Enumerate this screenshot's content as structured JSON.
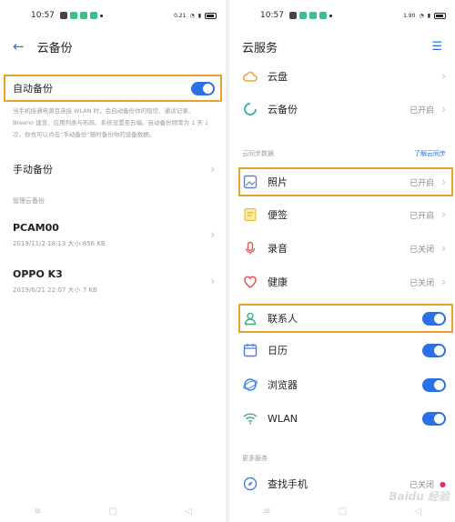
{
  "left": {
    "status": {
      "time": "10:57",
      "net_speed": "0.21"
    },
    "title": "云备份",
    "auto_backup": {
      "label": "自动备份",
      "on": true
    },
    "description": "当手机接通电源且连接 WLAN 时，会自动备份你的短信、通话记录、Breeno 速览、应用列表与布局、系统设置至云端。自动备份频率为 1 天 1 次，你也可以点击“手动备份”随时备份你的设备数据。",
    "manual_backup": "手动备份",
    "manage_section": "管理云备份",
    "devices": [
      {
        "name": "PCAM00",
        "sub": "2019/11/2 18:13  大小 856 KB"
      },
      {
        "name": "OPPO K3",
        "sub": "2019/6/21 22:07  大小 7 KB"
      }
    ]
  },
  "right": {
    "status": {
      "time": "10:57",
      "net_speed": "1.90"
    },
    "title": "云服务",
    "top_items": [
      {
        "label": "云盘",
        "icon": "cloud-icon",
        "state": ""
      },
      {
        "label": "云备份",
        "icon": "backup-icon",
        "state": "已开启"
      }
    ],
    "sync_section": "云同步数据",
    "learn_link": "了解云同步",
    "sync_items": [
      {
        "label": "照片",
        "icon": "photo-icon",
        "state": "已开启",
        "toggle": null
      },
      {
        "label": "便签",
        "icon": "note-icon",
        "state": "已开启",
        "toggle": null
      },
      {
        "label": "录音",
        "icon": "mic-icon",
        "state": "已关闭",
        "toggle": null
      },
      {
        "label": "健康",
        "icon": "heart-icon",
        "state": "已关闭",
        "toggle": null
      },
      {
        "label": "联系人",
        "icon": "contact-icon",
        "state": "",
        "toggle": true
      },
      {
        "label": "日历",
        "icon": "calendar-icon",
        "state": "",
        "toggle": true
      },
      {
        "label": "浏览器",
        "icon": "browser-icon",
        "state": "",
        "toggle": true
      },
      {
        "label": "WLAN",
        "icon": "wifi-icon",
        "state": "",
        "toggle": true
      }
    ],
    "more_section": "更多服务",
    "find_phone": {
      "label": "查找手机",
      "state": "已关闭"
    }
  },
  "watermark": "Baidu 经验",
  "colors": {
    "accent": "#2b70e6",
    "highlight": "#e9a12a"
  }
}
